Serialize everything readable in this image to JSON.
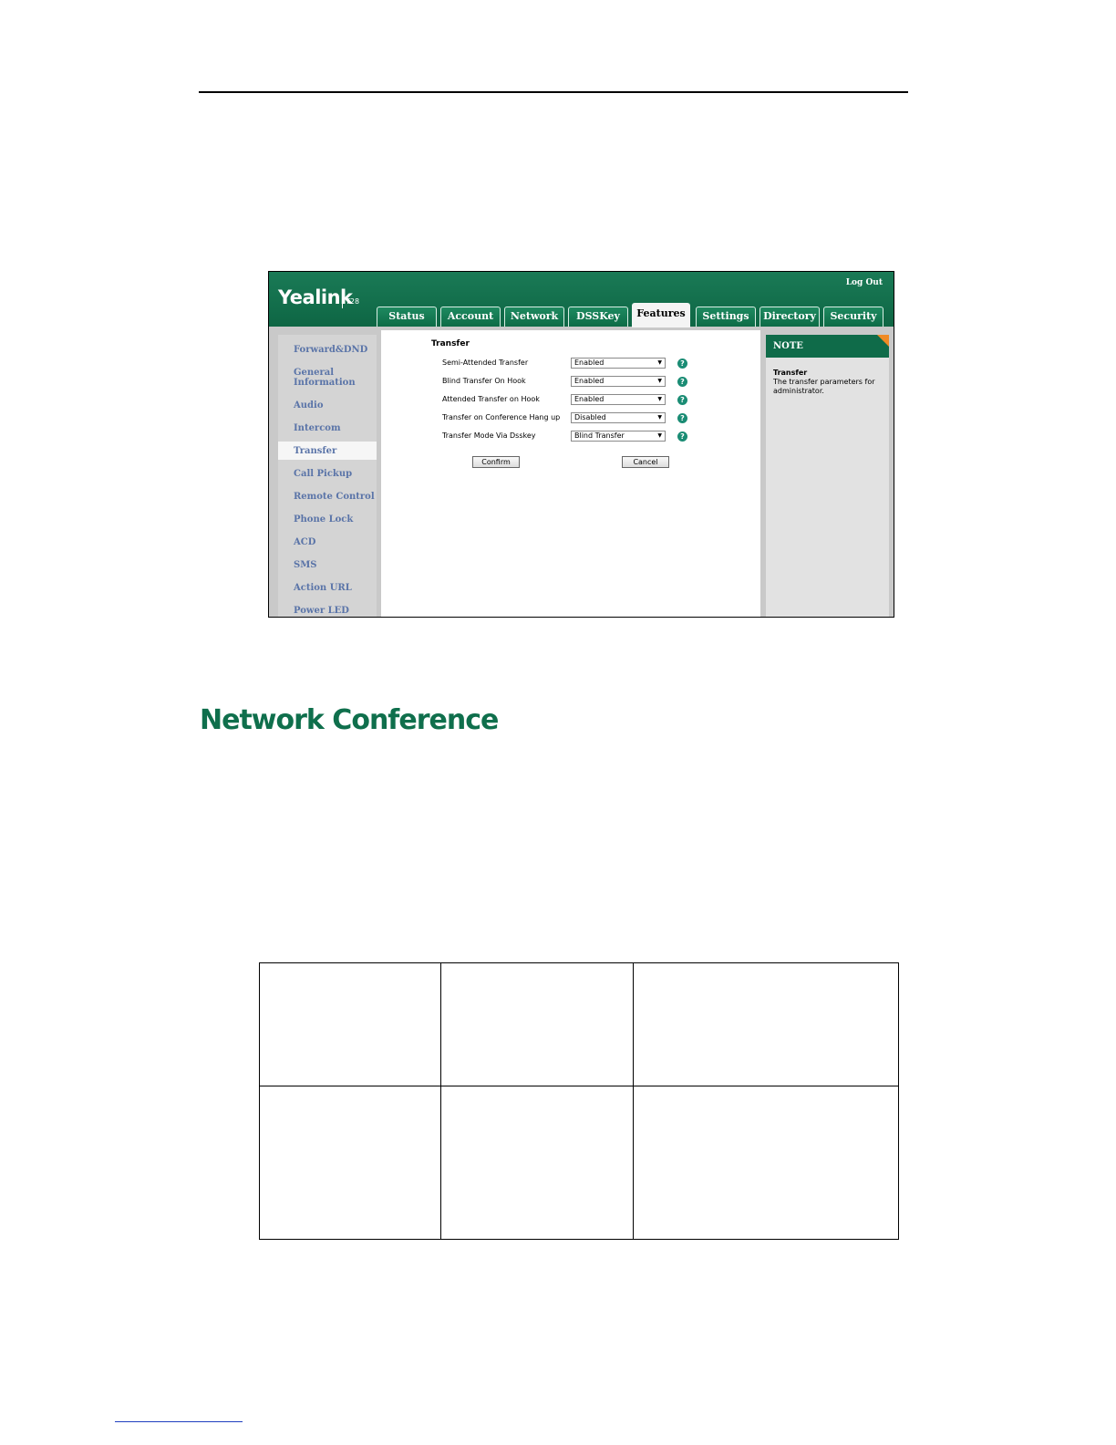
{
  "screenshot": {
    "logo": "Yealink",
    "model": "T28",
    "logout": "Log Out",
    "tabs": [
      "Status",
      "Account",
      "Network",
      "DSSKey",
      "Features",
      "Settings",
      "Directory",
      "Security"
    ],
    "active_tab": "Features",
    "sidebar": [
      "Forward&DND",
      "General Information",
      "Audio",
      "Intercom",
      "Transfer",
      "Call Pickup",
      "Remote Control",
      "Phone Lock",
      "ACD",
      "SMS",
      "Action URL",
      "Power LED"
    ],
    "active_sidebar": "Transfer",
    "section_title": "Transfer",
    "rows": [
      {
        "label": "Semi-Attended Transfer",
        "value": "Enabled"
      },
      {
        "label": "Blind Transfer On Hook",
        "value": "Enabled"
      },
      {
        "label": "Attended Transfer on Hook",
        "value": "Enabled"
      },
      {
        "label": "Transfer on Conference Hang up",
        "value": "Disabled"
      },
      {
        "label": "Transfer Mode Via Dsskey",
        "value": "Blind Transfer"
      }
    ],
    "help_glyph": "?",
    "confirm_label": "Confirm",
    "cancel_label": "Cancel",
    "note": {
      "heading": "NOTE",
      "title": "Transfer",
      "text": "The transfer parameters for administrator."
    }
  },
  "section_heading": "Network Conference"
}
